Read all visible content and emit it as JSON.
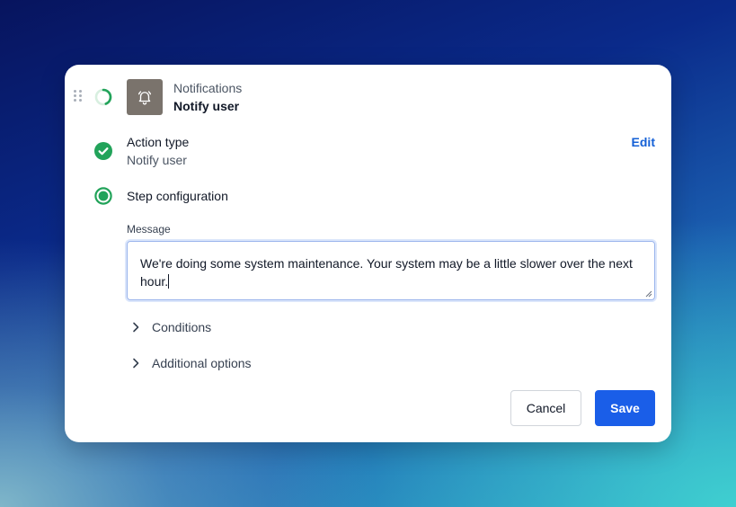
{
  "header": {
    "category": "Notifications",
    "title": "Notify user"
  },
  "steps": {
    "action_type": {
      "label": "Action type",
      "value": "Notify user",
      "edit_label": "Edit"
    },
    "step_configuration": {
      "label": "Step configuration"
    }
  },
  "message": {
    "label": "Message",
    "value": "We're doing some system maintenance. Your system may be a little slower over the next hour."
  },
  "sections": {
    "conditions": "Conditions",
    "additional_options": "Additional options"
  },
  "buttons": {
    "cancel": "Cancel",
    "save": "Save"
  },
  "colors": {
    "success": "#22a35a",
    "link": "#1460d6",
    "primary_button": "#1a5ee8",
    "app_icon_bg": "#7a736c"
  }
}
